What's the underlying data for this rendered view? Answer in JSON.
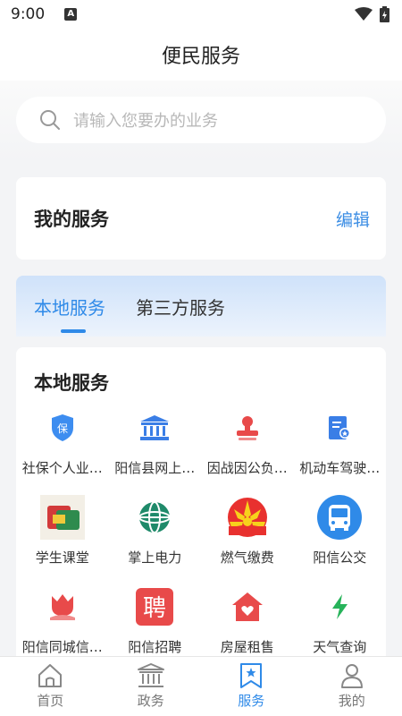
{
  "status_bar": {
    "time": "9:00",
    "notification_letter": "A"
  },
  "header": {
    "title": "便民服务"
  },
  "search": {
    "placeholder": "请输入您要办的业务"
  },
  "my_services": {
    "title": "我的服务",
    "edit_label": "编辑"
  },
  "tabs": [
    {
      "label": "本地服务",
      "active": true
    },
    {
      "label": "第三方服务",
      "active": false
    }
  ],
  "local_services": {
    "title": "本地服务",
    "items": [
      {
        "label": "社保个人业…",
        "icon": "social-insurance-shield-icon"
      },
      {
        "label": "阳信县网上…",
        "icon": "government-building-icon"
      },
      {
        "label": "因战因公负…",
        "icon": "official-seal-icon"
      },
      {
        "label": "机动车驾驶…",
        "icon": "driver-license-document-icon"
      },
      {
        "label": "学生课堂",
        "icon": "student-classroom-icon"
      },
      {
        "label": "掌上电力",
        "icon": "state-grid-logo-icon"
      },
      {
        "label": "燃气缴费",
        "icon": "petrochina-logo-icon"
      },
      {
        "label": "阳信公交",
        "icon": "bus-icon"
      },
      {
        "label": "阳信同城信…",
        "icon": "tulip-icon"
      },
      {
        "label": "阳信招聘",
        "icon": "recruit-pin-character-icon"
      },
      {
        "label": "房屋租售",
        "icon": "house-heart-icon"
      },
      {
        "label": "天气查询",
        "icon": "lightning-bolt-icon"
      }
    ]
  },
  "bottom_nav": [
    {
      "label": "首页",
      "icon": "home-icon",
      "active": false
    },
    {
      "label": "政务",
      "icon": "government-icon",
      "active": false
    },
    {
      "label": "服务",
      "icon": "service-bookmark-icon",
      "active": true
    },
    {
      "label": "我的",
      "icon": "profile-icon",
      "active": false
    }
  ],
  "colors": {
    "accent": "#2f8ae8",
    "edit_link": "#3b8de4",
    "tab_gradient_top": "#cfe2fa"
  }
}
